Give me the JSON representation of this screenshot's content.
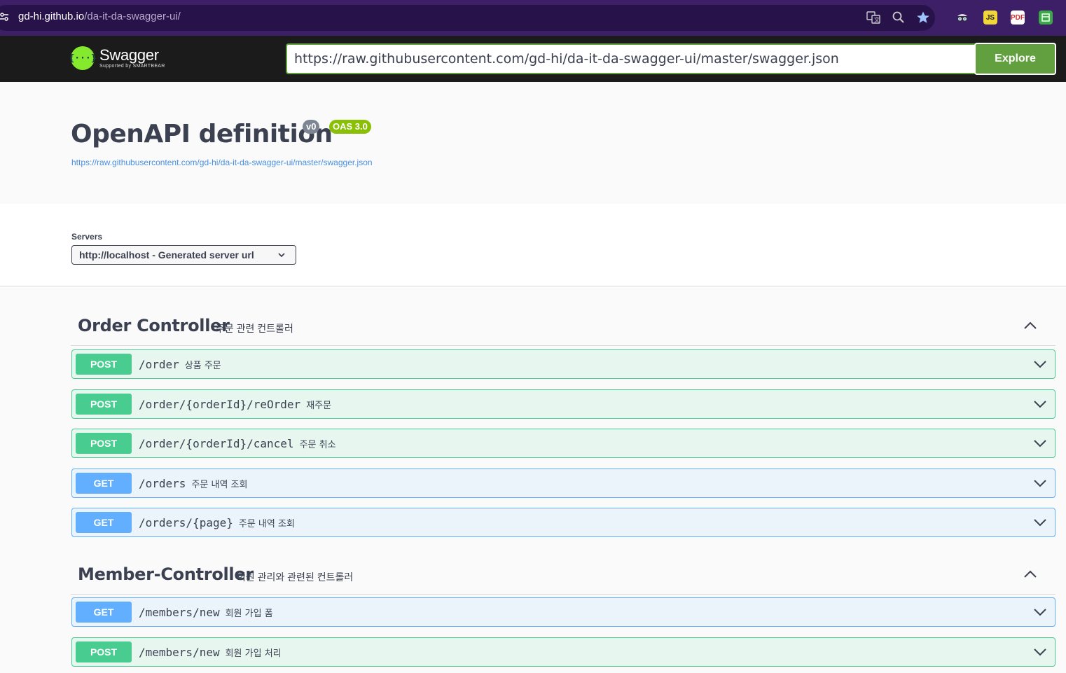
{
  "browser": {
    "url_host": "gd-hi.github.io",
    "url_path": "/da-it-da-swagger-ui/",
    "extensions": [
      "translate-icon",
      "zoom-icon",
      "bookmark-star-icon",
      "ext-spy-icon",
      "ext-js-icon",
      "ext-pdf-icon",
      "ext-green-icon"
    ]
  },
  "topbar": {
    "logo_name": "Swagger",
    "logo_sub": "Supported by SMARTBEAR",
    "spec_url": "https://raw.githubusercontent.com/gd-hi/da-it-da-swagger-ui/master/swagger.json",
    "explore_label": "Explore"
  },
  "info": {
    "title": "OpenAPI definition",
    "version": "v0",
    "oas": "OAS 3.0",
    "spec_link": "https://raw.githubusercontent.com/gd-hi/da-it-da-swagger-ui/master/swagger.json"
  },
  "servers": {
    "label": "Servers",
    "selected": "http://localhost - Generated server url"
  },
  "tags": [
    {
      "name": "Order Controller",
      "description": "주문 관련 컨트롤러",
      "operations": [
        {
          "method": "POST",
          "path": "/order",
          "summary": "상품 주문"
        },
        {
          "method": "POST",
          "path": "/order/{orderId}/reOrder",
          "summary": "재주문"
        },
        {
          "method": "POST",
          "path": "/order/{orderId}/cancel",
          "summary": "주문 취소"
        },
        {
          "method": "GET",
          "path": "/orders",
          "summary": "주문 내역 조회"
        },
        {
          "method": "GET",
          "path": "/orders/{page}",
          "summary": "주문 내역 조회"
        }
      ]
    },
    {
      "name": "Member-Controller",
      "description": "회원 관리와 관련된 컨트롤러",
      "operations": [
        {
          "method": "GET",
          "path": "/members/new",
          "summary": "회원 가입 폼"
        },
        {
          "method": "POST",
          "path": "/members/new",
          "summary": "회원 가입 처리"
        }
      ]
    }
  ],
  "colors": {
    "post": "#49cc90",
    "get": "#61affe",
    "explore": "#62a03f",
    "oas_badge": "#89bf04",
    "version_badge": "#7d8492",
    "browser_bar": "#3c1f66"
  }
}
